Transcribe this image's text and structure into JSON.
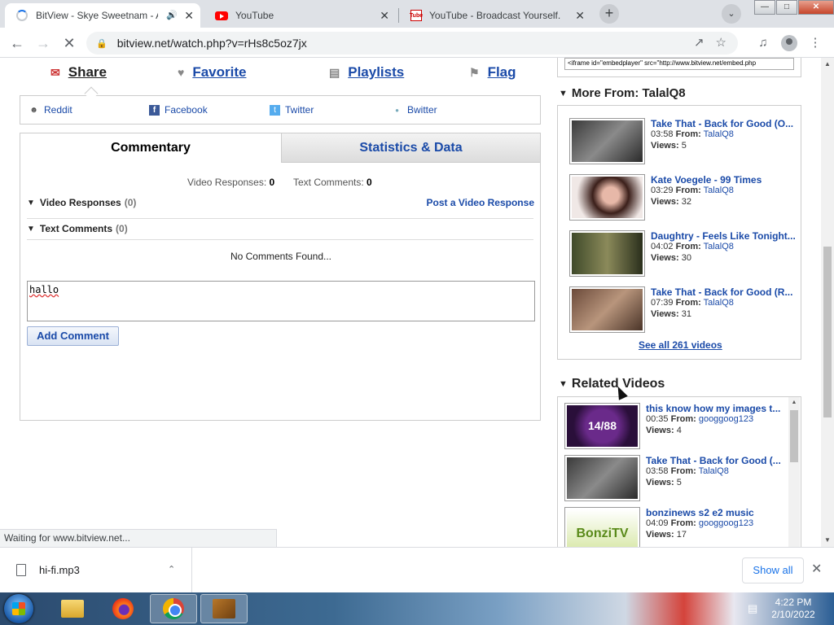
{
  "browser": {
    "tabs": [
      {
        "title": "BitView - Skye Sweetnam - A",
        "icon": "loading-spinner",
        "audio": true
      },
      {
        "title": "YouTube",
        "icon": "youtube-icon"
      },
      {
        "title": "YouTube - Broadcast Yourself.",
        "icon": "youtube-classic-icon"
      }
    ],
    "url": "bitview.net/watch.php?v=rHs8c5oz7jx",
    "status_text": "Waiting for www.bitview.net..."
  },
  "share_bar": {
    "items": [
      {
        "label": "Share",
        "icon": "envelope-icon"
      },
      {
        "label": "Favorite",
        "icon": "heart-icon"
      },
      {
        "label": "Playlists",
        "icon": "playlist-icon"
      },
      {
        "label": "Flag",
        "icon": "flag-icon"
      }
    ],
    "social": [
      {
        "label": "Reddit",
        "icon": "reddit-icon"
      },
      {
        "label": "Facebook",
        "icon": "facebook-icon"
      },
      {
        "label": "Twitter",
        "icon": "twitter-icon"
      },
      {
        "label": "Bwitter",
        "icon": "bwitter-icon"
      }
    ]
  },
  "panel": {
    "tabs": [
      "Commentary",
      "Statistics & Data"
    ],
    "video_responses_label": "Video Responses:",
    "video_responses_count": "0",
    "text_comments_label": "Text Comments:",
    "text_comments_count": "0",
    "sections": [
      {
        "label": "Video Responses",
        "count": "(0)"
      },
      {
        "label": "Text Comments",
        "count": "(0)"
      }
    ],
    "post_response": "Post a Video Response",
    "no_comments": "No Comments Found...",
    "comment_value": "hallo",
    "add_comment": "Add Comment"
  },
  "sidebar": {
    "embed_code": "<iframe id=\"embedplayer\" src=\"http://www.bitview.net/embed.php",
    "more_from_title": "More From: TalalQ8",
    "more_from": [
      {
        "title": "Take That - Back for Good (O...",
        "duration": "03:58",
        "from_label": "From:",
        "user": "TalalQ8",
        "views_label": "Views:",
        "views": "5"
      },
      {
        "title": "Kate Voegele - 99 Times",
        "duration": "03:29",
        "from_label": "From:",
        "user": "TalalQ8",
        "views_label": "Views:",
        "views": "32"
      },
      {
        "title": "Daughtry - Feels Like Tonight...",
        "duration": "04:02",
        "from_label": "From:",
        "user": "TalalQ8",
        "views_label": "Views:",
        "views": "30"
      },
      {
        "title": "Take That - Back for Good (R...",
        "duration": "07:39",
        "from_label": "From:",
        "user": "TalalQ8",
        "views_label": "Views:",
        "views": "31"
      }
    ],
    "see_all": "See all 261 videos",
    "related_title": "Related Videos",
    "related": [
      {
        "title": "this know how my images t...",
        "duration": "00:35",
        "from_label": "From:",
        "user": "googgoog123",
        "views_label": "Views:",
        "views": "4"
      },
      {
        "title": "Take That - Back for Good (...",
        "duration": "03:58",
        "from_label": "From:",
        "user": "TalalQ8",
        "views_label": "Views:",
        "views": "5"
      },
      {
        "title": "bonzinews s2 e2 music",
        "duration": "04:09",
        "from_label": "From:",
        "user": "googgoog123",
        "views_label": "Views:",
        "views": "17"
      }
    ]
  },
  "downloads": {
    "file": "hi-fi.mp3",
    "show_all": "Show all"
  },
  "taskbar": {
    "time": "4:22 PM",
    "date": "2/10/2022"
  },
  "colors": {
    "link_blue": "#1a4aa8",
    "chrome_tabstrip": "#dee1e6"
  }
}
